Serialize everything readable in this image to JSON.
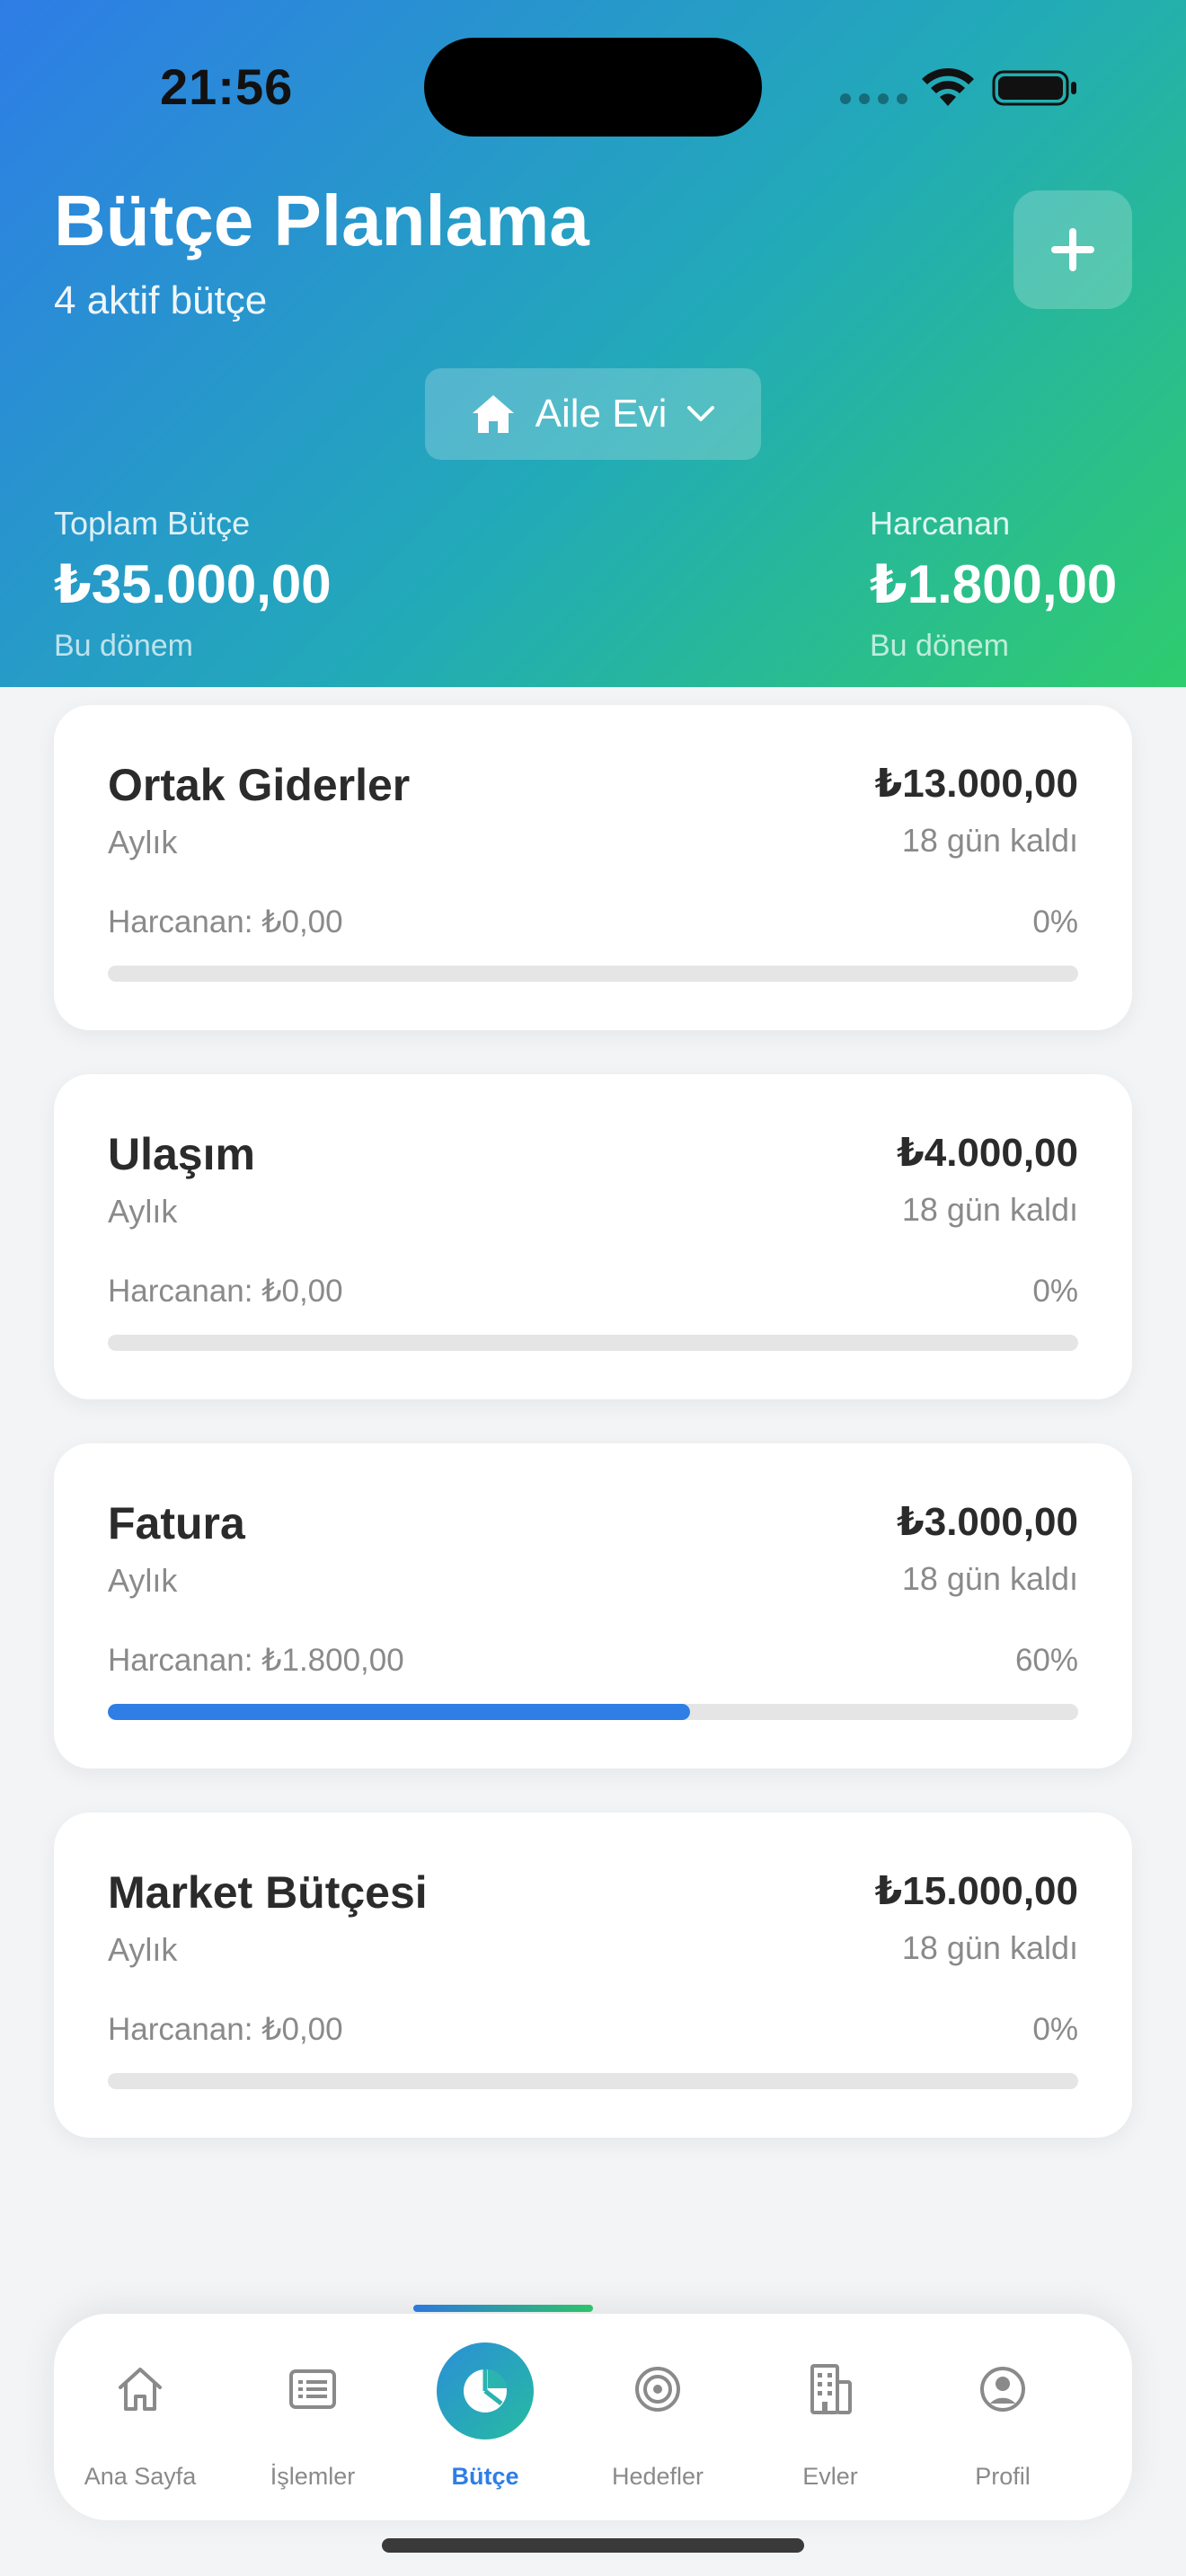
{
  "status_bar": {
    "time": "21:56"
  },
  "header": {
    "title": "Bütçe Planlama",
    "subtitle": "4 aktif bütçe",
    "house_selector": "Aile Evi"
  },
  "summary": {
    "total": {
      "label": "Toplam Bütçe",
      "value": "₺35.000,00",
      "period": "Bu dönem"
    },
    "spent": {
      "label": "Harcanan",
      "value": "₺1.800,00",
      "period": "Bu dönem"
    }
  },
  "budgets": [
    {
      "name": "Ortak Giderler",
      "period": "Aylık",
      "amount": "₺13.000,00",
      "days_left": "18 gün kaldı",
      "spent": "Harcanan: ₺0,00",
      "percent_label": "0%",
      "progress": 0
    },
    {
      "name": "Ulaşım",
      "period": "Aylık",
      "amount": "₺4.000,00",
      "days_left": "18 gün kaldı",
      "spent": "Harcanan: ₺0,00",
      "percent_label": "0%",
      "progress": 0
    },
    {
      "name": "Fatura",
      "period": "Aylık",
      "amount": "₺3.000,00",
      "days_left": "18 gün kaldı",
      "spent": "Harcanan: ₺1.800,00",
      "percent_label": "60%",
      "progress": 0.6
    },
    {
      "name": "Market Bütçesi",
      "period": "Aylık",
      "amount": "₺15.000,00",
      "days_left": "18 gün kaldı",
      "spent": "Harcanan: ₺0,00",
      "percent_label": "0%",
      "progress": 0
    }
  ],
  "tabbar": {
    "items": [
      {
        "label": "Ana Sayfa",
        "icon": "home-icon",
        "active": false
      },
      {
        "label": "İşlemler",
        "icon": "list-icon",
        "active": false
      },
      {
        "label": "Bütçe",
        "icon": "pie-chart-icon",
        "active": true
      },
      {
        "label": "Hedefler",
        "icon": "target-icon",
        "active": false
      },
      {
        "label": "Evler",
        "icon": "building-icon",
        "active": false
      },
      {
        "label": "Profil",
        "icon": "profile-icon",
        "active": false
      }
    ]
  },
  "colors": {
    "accent": "#2f7ee6",
    "gradient_start": "#2e7de6",
    "gradient_end": "#2fcc6e",
    "progress_track": "#e5e5e5"
  }
}
